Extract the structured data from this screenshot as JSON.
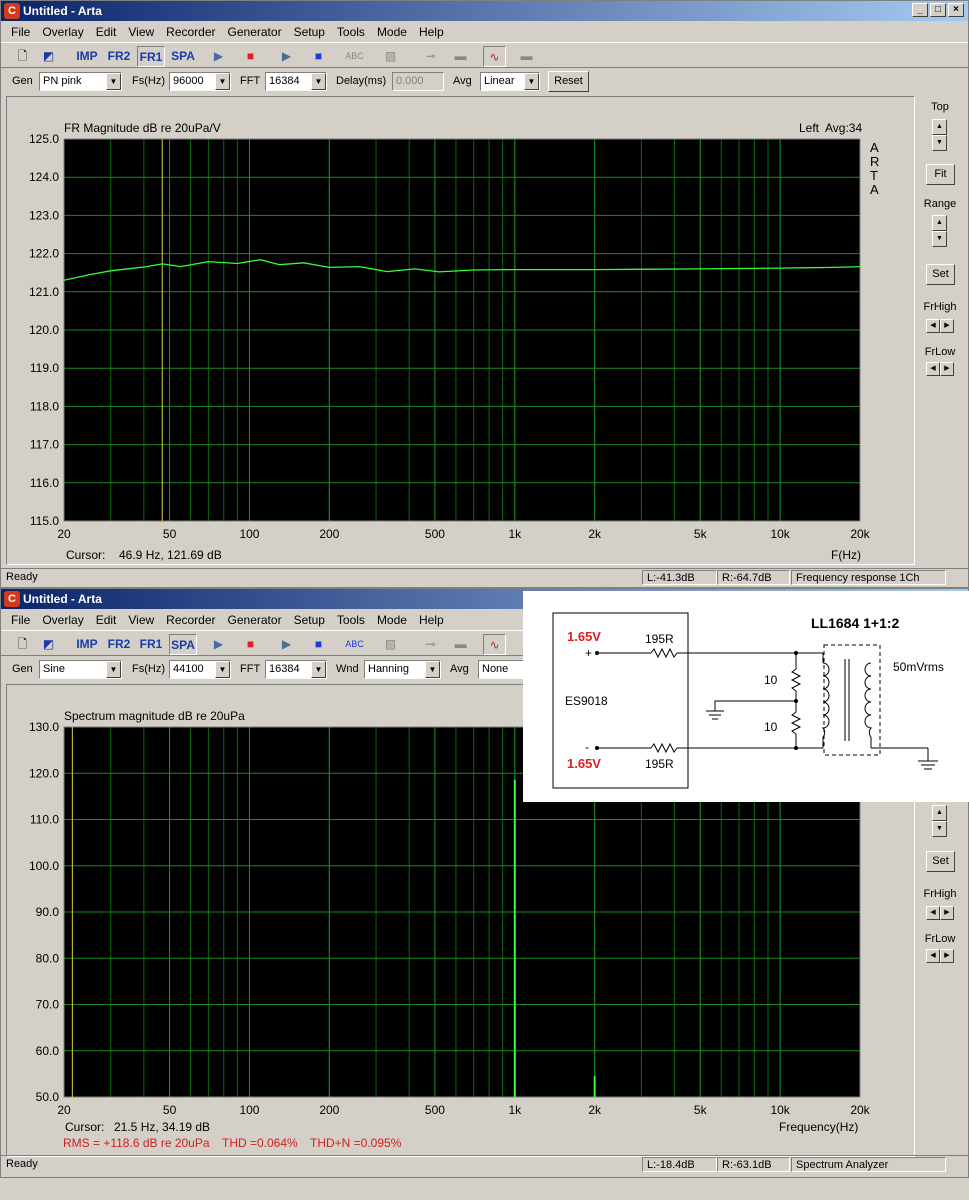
{
  "window1": {
    "title": "Untitled - Arta",
    "menu": [
      "File",
      "Overlay",
      "Edit",
      "View",
      "Recorder",
      "Generator",
      "Setup",
      "Tools",
      "Mode",
      "Help"
    ],
    "toolbar_modes": [
      "IMP",
      "FR2",
      "FR1",
      "SPA"
    ],
    "params": {
      "gen_label": "Gen",
      "gen_value": "PN pink",
      "fs_label": "Fs(Hz)",
      "fs_value": "96000",
      "fft_label": "FFT",
      "fft_value": "16384",
      "delay_label": "Delay(ms)",
      "delay_value": "0.000",
      "avg_label": "Avg",
      "avg_value": "Linear",
      "reset_label": "Reset"
    },
    "plot": {
      "title": "FR Magnitude dB re 20uPa/V",
      "channel": "Left",
      "avg": "Avg:34",
      "watermark": [
        "A",
        "R",
        "T",
        "A"
      ],
      "cursor_label": "Cursor:",
      "cursor_value": "46.9 Hz, 121.69 dB",
      "x_axis_label": "F(Hz)"
    },
    "sidebar": {
      "top": "Top",
      "fit": "Fit",
      "range": "Range",
      "set": "Set",
      "frhigh": "FrHigh",
      "frlow": "FrLow"
    },
    "status": {
      "left": "Ready",
      "l": "L:-41.3dB",
      "r": "R:-64.7dB",
      "mode": "Frequency response 1Ch"
    }
  },
  "window2": {
    "title": "Untitled - Arta",
    "menu": [
      "File",
      "Overlay",
      "Edit",
      "View",
      "Recorder",
      "Generator",
      "Setup",
      "Tools",
      "Mode",
      "Help"
    ],
    "toolbar_modes": [
      "IMP",
      "FR2",
      "FR1",
      "SPA"
    ],
    "params": {
      "gen_label": "Gen",
      "gen_value": "Sine",
      "fs_label": "Fs(Hz)",
      "fs_value": "44100",
      "fft_label": "FFT",
      "fft_value": "16384",
      "wnd_label": "Wnd",
      "wnd_value": "Hanning",
      "avg_label": "Avg",
      "avg_value": "None"
    },
    "plot": {
      "title": "Spectrum magnitude dB re 20uPa",
      "cursor_label": "Cursor:",
      "cursor_value": "21.5 Hz, 34.19 dB",
      "x_axis_label": "Frequency(Hz)",
      "rms": "RMS = +118.6 dB re 20uPa",
      "thd": "THD =0.064%",
      "thdn": "THD+N =0.095%"
    },
    "sidebar": {
      "set": "Set",
      "frhigh": "FrHigh",
      "frlow": "FrLow"
    },
    "status": {
      "left": "Ready",
      "l": "L:-18.4dB",
      "r": "R:-63.1dB",
      "mode": "Spectrum Analyzer"
    }
  },
  "circuit": {
    "title": "LL1684 1+1:2",
    "chip": "ES9018",
    "v_top": "1.65V",
    "v_bottom": "1.65V",
    "plus": "+",
    "minus": "-",
    "r_top": "195R",
    "r_bottom": "195R",
    "r_mid_top": "10",
    "r_mid_bottom": "10",
    "output": "50mVrms"
  },
  "chart_data": [
    {
      "type": "line",
      "title": "FR Magnitude dB re 20uPa/V",
      "xlabel": "F(Hz)",
      "x_scale": "log",
      "xlim": [
        20,
        20000
      ],
      "ylim": [
        115,
        125
      ],
      "x_ticks": [
        "20",
        "50",
        "100",
        "200",
        "500",
        "1k",
        "2k",
        "5k",
        "10k",
        "20k"
      ],
      "y_ticks": [
        "125.0",
        "124.0",
        "123.0",
        "122.0",
        "121.0",
        "120.0",
        "119.0",
        "118.0",
        "117.0",
        "116.0",
        "115.0"
      ],
      "grid": true,
      "background": "#000000",
      "line_color": "#33ff33",
      "cursor_x": 46.9,
      "series": [
        {
          "x": [
            20,
            25,
            30,
            40,
            47,
            55,
            70,
            90,
            110,
            130,
            160,
            200,
            260,
            330,
            420,
            520,
            700,
            1000,
            2000,
            5000,
            10000,
            13000,
            16000,
            20000
          ],
          "values": [
            121.3,
            121.45,
            121.55,
            121.65,
            121.69,
            121.7,
            121.75,
            121.78,
            121.8,
            121.75,
            121.72,
            121.68,
            121.62,
            121.57,
            121.56,
            121.56,
            121.57,
            121.58,
            121.58,
            121.6,
            121.62,
            121.63,
            121.64,
            121.66
          ]
        }
      ]
    },
    {
      "type": "line",
      "title": "Spectrum magnitude dB re 20uPa",
      "xlabel": "Frequency(Hz)",
      "x_scale": "log",
      "xlim": [
        20,
        20000
      ],
      "ylim": [
        50,
        130
      ],
      "x_ticks": [
        "20",
        "50",
        "100",
        "200",
        "500",
        "1k",
        "2k",
        "5k",
        "10k",
        "20k"
      ],
      "y_ticks": [
        "130.0",
        "120.0",
        "110.0",
        "100.0",
        "90.0",
        "80.0",
        "70.0",
        "60.0",
        "50.0"
      ],
      "grid": true,
      "background": "#000000",
      "line_color": "#33ff33",
      "cursor_x": 21.5,
      "peaks": [
        {
          "x": 1000,
          "y": 118.6
        },
        {
          "x": 2000,
          "y": 54.5
        }
      ]
    }
  ]
}
